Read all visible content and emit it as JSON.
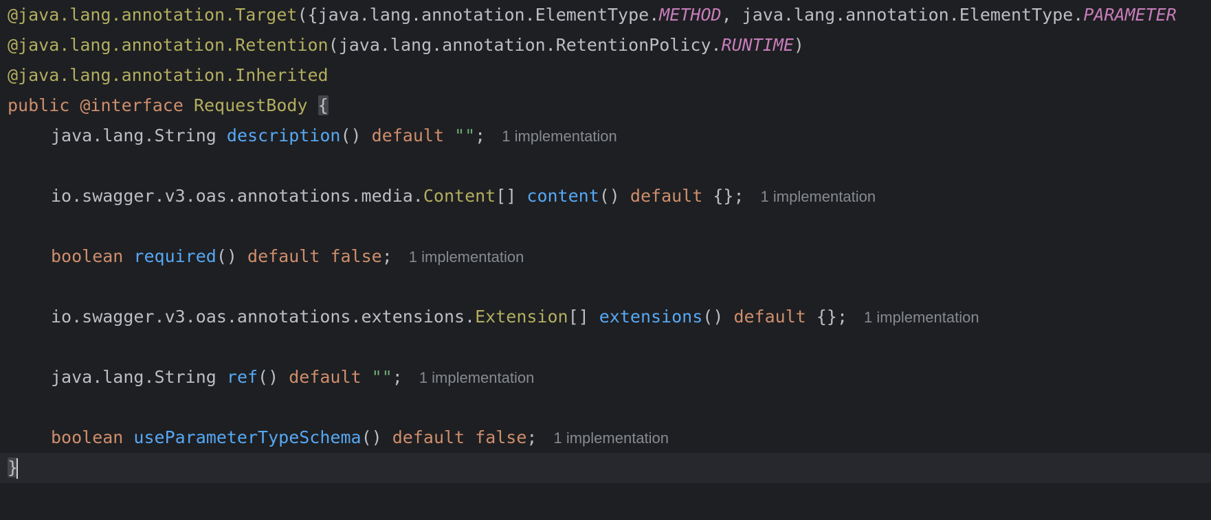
{
  "code": {
    "line1": {
      "p1": "@java.lang.annotation.",
      "ann": "Target",
      "p2": "({java.lang.annotation.ElementType.",
      "c1": "METHOD",
      "p3": ", java.lang.annotation.ElementType.",
      "c2": "PARAMETER"
    },
    "line2": {
      "p1": "@java.lang.annotation.",
      "ann": "Retention",
      "p2": "(java.lang.annotation.RetentionPolicy.",
      "c1": "RUNTIME",
      "p3": ")"
    },
    "line3": {
      "p1": "@java.lang.annotation.",
      "ann": "Inherited"
    },
    "line4": {
      "kw1": "public",
      "kw2": "@interface",
      "name": "RequestBody",
      "brace": "{"
    },
    "members": [
      {
        "type": "java.lang.String",
        "name": "description",
        "parens": "()",
        "kw": "default",
        "value": "\"\"",
        "end": ";",
        "hint": "1 implementation"
      },
      {
        "type_prefix": "io.swagger.v3.oas.annotations.media.",
        "type_ann": "Content",
        "type_suffix": "[]",
        "name": "content",
        "parens": "()",
        "kw": "default",
        "value": "{}",
        "end": ";",
        "hint": "1 implementation"
      },
      {
        "type_kw": "boolean",
        "name": "required",
        "parens": "()",
        "kw": "default",
        "value_kw": "false",
        "end": ";",
        "hint": "1 implementation"
      },
      {
        "type_prefix": "io.swagger.v3.oas.annotations.extensions.",
        "type_ann": "Extension",
        "type_suffix": "[]",
        "name": "extensions",
        "parens": "()",
        "kw": "default",
        "value": "{}",
        "end": ";",
        "hint": "1 implementation"
      },
      {
        "type": "java.lang.String",
        "name": "ref",
        "parens": "()",
        "kw": "default",
        "value": "\"\"",
        "end": ";",
        "hint": "1 implementation"
      },
      {
        "type_kw": "boolean",
        "name": "useParameterTypeSchema",
        "parens": "()",
        "kw": "default",
        "value_kw": "false",
        "end": ";",
        "hint": "1 implementation"
      }
    ],
    "closing_brace": "}"
  },
  "colors": {
    "background": "#1e1f22",
    "current_line": "#26282e",
    "keyword": "#cf8e6d",
    "annotation": "#b3ae60",
    "function": "#56a8f5",
    "string": "#6aab73",
    "constant": "#c77dbb",
    "hint": "#868a91"
  }
}
